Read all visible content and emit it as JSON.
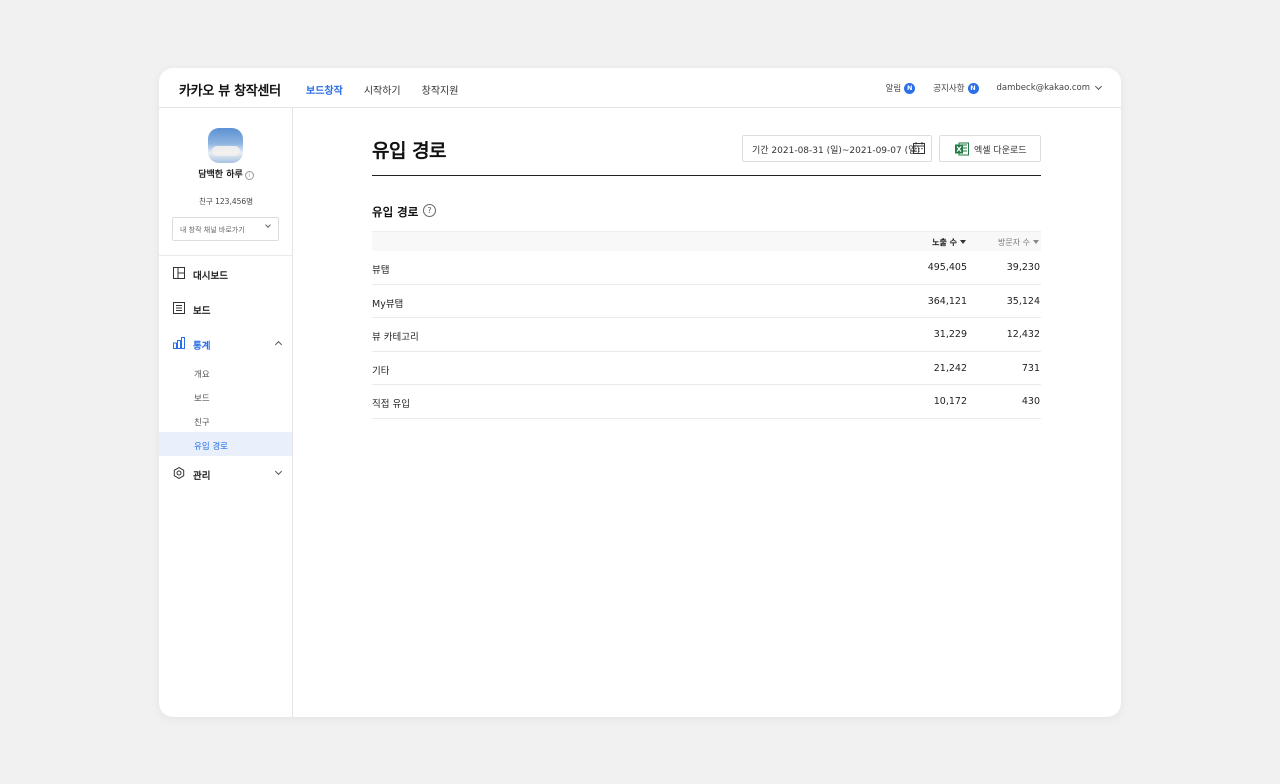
{
  "header": {
    "brand": "카카오 뷰 창작센터",
    "nav": [
      "보드창작",
      "시작하기",
      "창작지원"
    ],
    "active_nav": 0,
    "alerts_label": "알림",
    "notice_label": "공지사항",
    "badge": "N",
    "account": "dambeck@kakao.com"
  },
  "sidebar": {
    "channel_name": "담백한 하루",
    "friends_label": "친구",
    "friends_count": "123,456명",
    "channel_select_placeholder": "내 창작 채널 바로가기",
    "menu": {
      "dashboard": "대시보드",
      "board": "보드",
      "stats": "통계",
      "manage": "관리"
    },
    "stats_sub": [
      "개요",
      "보드",
      "친구",
      "유입 경로"
    ],
    "active_sub": 3
  },
  "main": {
    "page_title": "유입 경로",
    "period_label": "기간 2021-08-31 (일)~2021-09-07 (일)",
    "excel_button": "엑셀 다운로드",
    "section_title": "유입 경로",
    "help": "?",
    "columns": {
      "impressions": "노출 수",
      "visitors": "방문자 수"
    },
    "rows": [
      {
        "source": "뷰탭",
        "impressions": "495,405",
        "visitors": "39,230"
      },
      {
        "source": "My뷰탭",
        "impressions": "364,121",
        "visitors": "35,124"
      },
      {
        "source": "뷰 카테고리",
        "impressions": "31,229",
        "visitors": "12,432"
      },
      {
        "source": "기타",
        "impressions": "21,242",
        "visitors": "731"
      },
      {
        "source": "직접 유입",
        "impressions": "10,172",
        "visitors": "430"
      }
    ]
  },
  "colors": {
    "accent": "#2a6ee8",
    "page_bg": "#f1f1f1",
    "excel_green": "#1f7a43"
  },
  "icons": [
    "dashboard-icon",
    "board-icon",
    "stats-icon",
    "settings-icon",
    "calendar-icon",
    "excel-icon",
    "help-icon",
    "info-icon"
  ]
}
